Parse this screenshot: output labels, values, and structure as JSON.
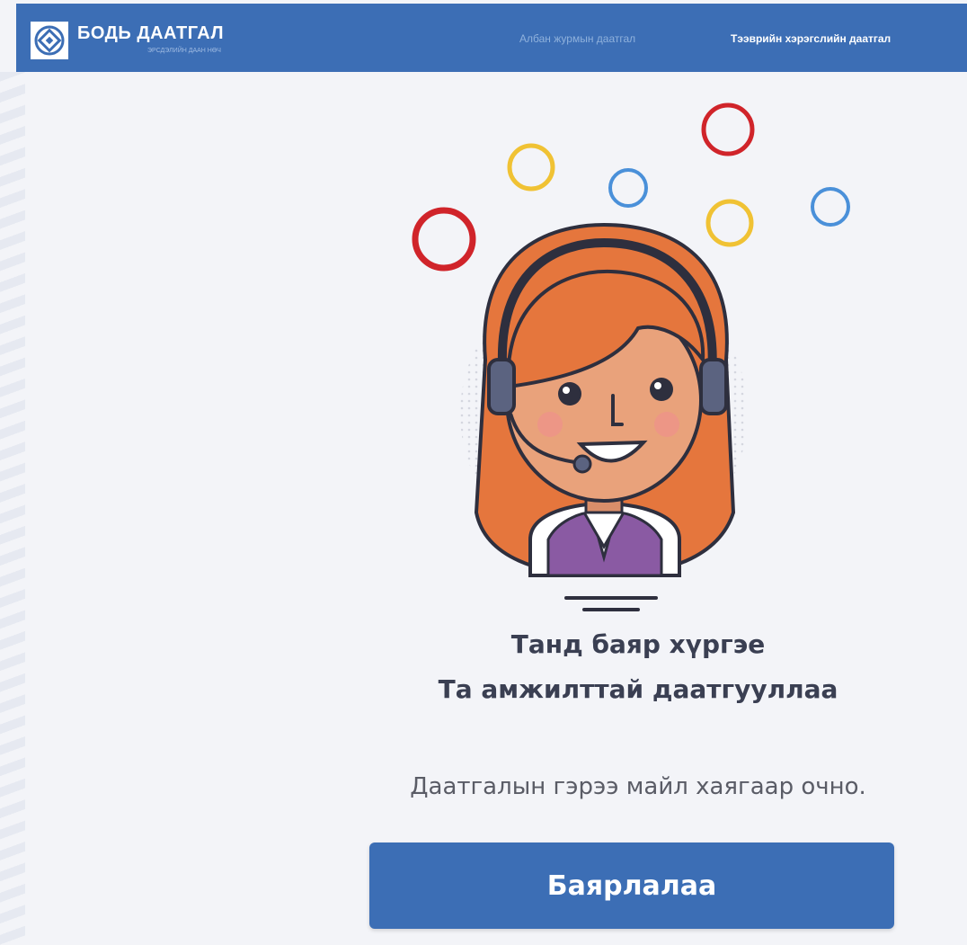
{
  "header": {
    "brand_title": "БОДЬ ДААТГАЛ",
    "brand_subtitle": "ЭРСДЭЛИЙН ДААН НӨЧ",
    "nav": [
      {
        "label": "Албан журмын даатгал",
        "active": false
      },
      {
        "label": "Тээврийн хэрэгслийн даатгал",
        "active": true
      }
    ],
    "colors": {
      "bar": "#3c6eb5",
      "inactive_link": "#8fb1dc",
      "active_link": "#ffffff"
    }
  },
  "illustration": {
    "icon": "support-agent-icon",
    "decor_rings": [
      "red",
      "yellow",
      "blue",
      "red",
      "yellow",
      "blue"
    ]
  },
  "message": {
    "line1": "Танд баяр хүргэе",
    "line2": "Та амжилттай даатгууллаа",
    "info": "Даатгалын гэрээ майл хаягаар очно."
  },
  "button": {
    "label": "Баярлалаа"
  },
  "colors": {
    "primary": "#3c6eb5",
    "background": "#f3f4f8",
    "text": "#3a3f52"
  }
}
